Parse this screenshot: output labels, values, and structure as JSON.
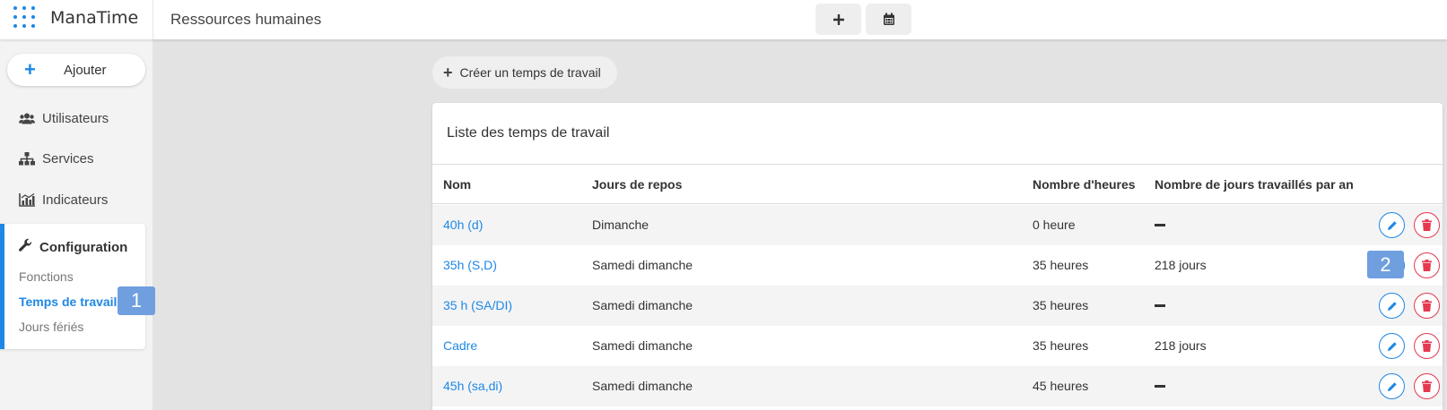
{
  "header": {
    "brand": "ManaTime",
    "section": "Ressources humaines",
    "buttons": [
      "plus-icon",
      "calendar-icon"
    ]
  },
  "sidebar": {
    "add_label": "Ajouter",
    "items": [
      {
        "label": "Utilisateurs",
        "icon": "users-icon"
      },
      {
        "label": "Services",
        "icon": "org-chart-icon"
      },
      {
        "label": "Indicateurs",
        "icon": "chart-icon"
      }
    ],
    "config": {
      "label": "Configuration",
      "icon": "wrench-icon",
      "sub_items": [
        {
          "label": "Fonctions",
          "active": false
        },
        {
          "label": "Temps de travail",
          "active": true
        },
        {
          "label": "Jours fériés",
          "active": false
        }
      ]
    }
  },
  "badges": [
    "1",
    "2"
  ],
  "main": {
    "create_label": "Créer un temps de travail",
    "card_title": "Liste des temps de travail",
    "columns": [
      "Nom",
      "Jours de repos",
      "Nombre d'heures",
      "Nombre de jours travaillés par an"
    ],
    "rows": [
      {
        "nom": "40h (d)",
        "repos": "Dimanche",
        "heures": "0 heure",
        "jours": ""
      },
      {
        "nom": "35h (S,D)",
        "repos": "Samedi dimanche",
        "heures": "35 heures",
        "jours": "218 jours"
      },
      {
        "nom": "35 h (SA/DI)",
        "repos": "Samedi dimanche",
        "heures": "35 heures",
        "jours": ""
      },
      {
        "nom": "Cadre",
        "repos": "Samedi dimanche",
        "heures": "35 heures",
        "jours": "218 jours"
      },
      {
        "nom": "45h (sa,di)",
        "repos": "Samedi dimanche",
        "heures": "45 heures",
        "jours": ""
      }
    ]
  },
  "colors": {
    "accent": "#1e88e5",
    "danger": "#e53950",
    "badge": "#6f9fdf"
  }
}
